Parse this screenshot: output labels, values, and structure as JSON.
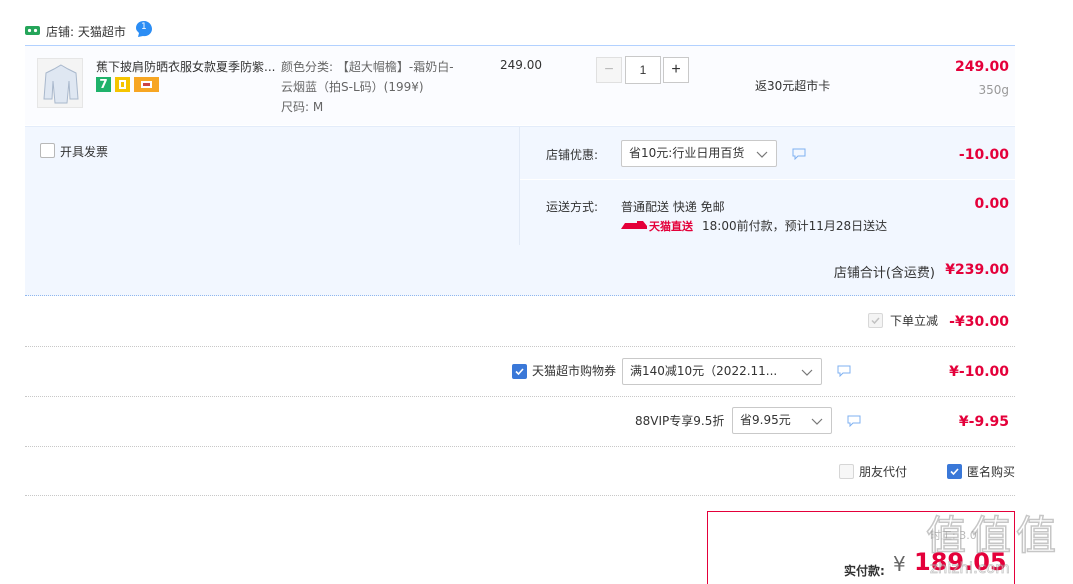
{
  "shop": {
    "label": "店铺: 天猫超市",
    "badge_count": "1"
  },
  "item": {
    "title": "蕉下披肩防晒衣服女款夏季防紫...",
    "spec_line1": "颜色分类: 【超大帽檐】-霜奶白-",
    "spec_line2": "云烟蓝（拍S-L码）(199¥)",
    "spec_line3": "尺码: M",
    "unit_price": "249.00",
    "quantity": "1",
    "minus_label": "−",
    "plus_label": "+",
    "rebate": "返30元超市卡",
    "total_price": "249.00",
    "weight": "350g",
    "badge_seven": "7",
    "badge_seven_color": "#1fb26b"
  },
  "invoice": {
    "label": "开具发票"
  },
  "shop_discount": {
    "label": "店铺优惠:",
    "selected": "省10元:行业日用百货",
    "amount": "-10.00"
  },
  "shipping": {
    "label": "运送方式:",
    "method": "普通配送 快递 免邮",
    "badge": "天猫直送",
    "eta": "18:00前付款，预计11月28日送达",
    "amount": "0.00"
  },
  "shop_total": {
    "label": "店铺合计(含运费)",
    "amount": "¥239.00"
  },
  "instant_discount": {
    "label": "下单立减",
    "amount": "-¥30.00"
  },
  "coupon": {
    "label": "天猫超市购物券",
    "selected": "满140减10元（2022.11...",
    "amount": "¥-10.00"
  },
  "vip": {
    "label": "88VIP专享9.5折",
    "selected": "省9.95元",
    "amount": "¥-9.95"
  },
  "options": {
    "friend_pay": "朋友代付",
    "anonymous": "匿名购买"
  },
  "payment": {
    "label": "实付款:",
    "currency": "¥",
    "amount": "189.05",
    "faded_text": "时工: 3.0"
  },
  "watermark": {
    "logo": "值",
    "site": "zhizhi.com"
  },
  "colors": {
    "accent_red": "#e4003a",
    "panel_blue": "#f2f7ff",
    "border_blue": "#b2d1ff"
  }
}
